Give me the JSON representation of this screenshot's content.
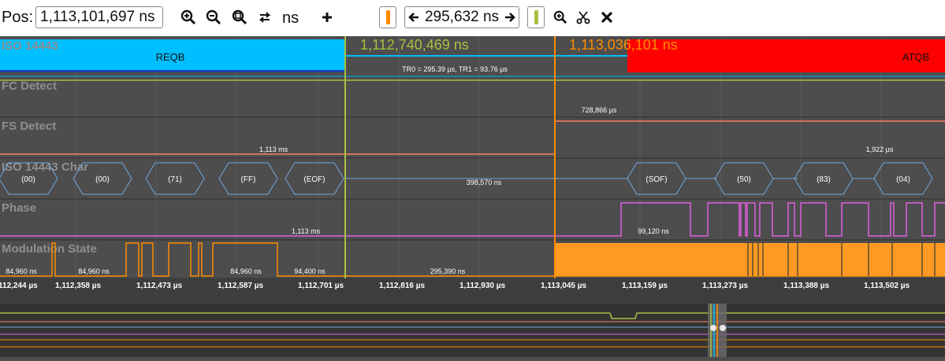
{
  "toolbar": {
    "pos_label": "Pos:",
    "pos_value": "1,113,101,697 ns",
    "unit": "ns",
    "delta_value": "295,632 ns",
    "icons": [
      "zoom-in-icon",
      "zoom-out-icon",
      "zoom-fit-icon",
      "swap-icon",
      "add-icon",
      "scissors-icon",
      "close-icon"
    ]
  },
  "cursors": {
    "a_time": "1,112,740,469 ns",
    "b_time": "1,113,036,101 ns",
    "a_color": "#a8c040",
    "b_color": "#ff8c00"
  },
  "rows": {
    "iso14443": {
      "name": "ISO 14443",
      "reqb": "REQB",
      "atqb": "ATQB",
      "tr_text": "TR0 = 295.39 µs, TR1 = 93.76 µs",
      "reqb_color": "#00bfff",
      "atqb_color": "#ff0000"
    },
    "fc_detect": {
      "name": "FC Detect"
    },
    "fs_detect": {
      "name": "FS Detect",
      "label_top": "728,866 µs",
      "label_left": "1,113 ms",
      "label_right": "1,922 µs"
    },
    "char": {
      "name": "ISO 14443 Char",
      "left_symbols": [
        "(00)",
        "(00)",
        "(71)",
        "(FF)",
        "(EOF)"
      ],
      "gap_label": "398,570 ns",
      "right_symbols": [
        "(SOF)",
        "(50)",
        "(83)",
        "(04)"
      ]
    },
    "phase": {
      "name": "Phase",
      "label_left": "1,113 ms",
      "label_right": "99,120 ns"
    },
    "modulation": {
      "name": "Modulation State",
      "labels": [
        "84,960 ns",
        "84,960 ns",
        "84,960 ns",
        "94,400 ns",
        "295,390 ns"
      ]
    }
  },
  "axis_ticks": [
    "112,244 µs",
    "1,112,358 µs",
    "1,112,473 µs",
    "1,112,587 µs",
    "1,112,701 µs",
    "1,112,816 µs",
    "1,112,930 µs",
    "1,113,045 µs",
    "1,113,159 µs",
    "1,113,273 µs",
    "1,113,388 µs",
    "1,113,502 µs"
  ]
}
